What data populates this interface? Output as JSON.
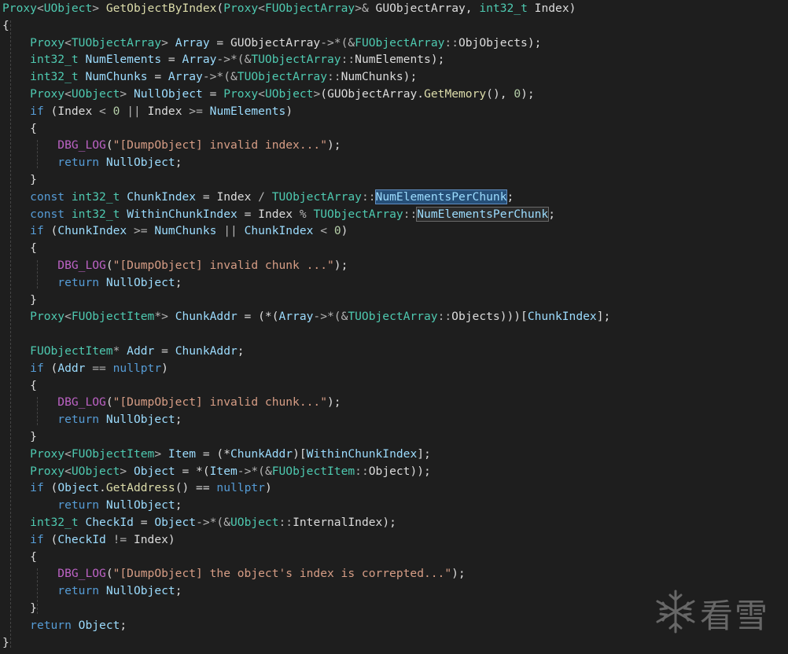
{
  "colors": {
    "background": "#1e1e1e",
    "default": "#dcdcdc",
    "keyword": "#569cd6",
    "type": "#4ec9b0",
    "function": "#dcdcaa",
    "variable": "#9cdcfe",
    "string": "#d69d85",
    "number": "#b5cea8",
    "macro": "#bd63c5",
    "operator": "#b4b4b4",
    "guide": "#444444",
    "watermark": "#7a7a7a"
  },
  "code_lines": [
    [
      [
        "Proxy",
        "type"
      ],
      [
        "<",
        "operator"
      ],
      [
        "UObject",
        "type"
      ],
      [
        "> ",
        "operator"
      ],
      [
        "GetObjectByIndex",
        "function"
      ],
      [
        "(",
        "default"
      ],
      [
        "Proxy",
        "type"
      ],
      [
        "<",
        "operator"
      ],
      [
        "FUObjectArray",
        "type"
      ],
      [
        ">& ",
        "operator"
      ],
      [
        "GUObjectArray",
        "param"
      ],
      [
        ", ",
        "default"
      ],
      [
        "int32_t",
        "type"
      ],
      [
        " ",
        "default"
      ],
      [
        "Index",
        "param"
      ],
      [
        ")",
        "default"
      ]
    ],
    [
      [
        "{",
        "default"
      ]
    ],
    [
      [
        "    ",
        "default"
      ],
      [
        "Proxy",
        "type"
      ],
      [
        "<",
        "operator"
      ],
      [
        "TUObjectArray",
        "type"
      ],
      [
        "> ",
        "operator"
      ],
      [
        "Array",
        "variable"
      ],
      [
        " = ",
        "default"
      ],
      [
        "GUObjectArray",
        "param"
      ],
      [
        "->*(&",
        "operator"
      ],
      [
        "FUObjectArray",
        "type"
      ],
      [
        "::",
        "operator"
      ],
      [
        "ObjObjects",
        "default"
      ],
      [
        ");",
        "default"
      ]
    ],
    [
      [
        "    ",
        "default"
      ],
      [
        "int32_t",
        "type"
      ],
      [
        " ",
        "default"
      ],
      [
        "NumElements",
        "variable"
      ],
      [
        " = ",
        "default"
      ],
      [
        "Array",
        "variable"
      ],
      [
        "->*(&",
        "operator"
      ],
      [
        "TUObjectArray",
        "type"
      ],
      [
        "::",
        "operator"
      ],
      [
        "NumElements",
        "default"
      ],
      [
        ");",
        "default"
      ]
    ],
    [
      [
        "    ",
        "default"
      ],
      [
        "int32_t",
        "type"
      ],
      [
        " ",
        "default"
      ],
      [
        "NumChunks",
        "variable"
      ],
      [
        " = ",
        "default"
      ],
      [
        "Array",
        "variable"
      ],
      [
        "->*(&",
        "operator"
      ],
      [
        "TUObjectArray",
        "type"
      ],
      [
        "::",
        "operator"
      ],
      [
        "NumChunks",
        "default"
      ],
      [
        ");",
        "default"
      ]
    ],
    [
      [
        "    ",
        "default"
      ],
      [
        "Proxy",
        "type"
      ],
      [
        "<",
        "operator"
      ],
      [
        "UObject",
        "type"
      ],
      [
        "> ",
        "operator"
      ],
      [
        "NullObject",
        "variable"
      ],
      [
        " = ",
        "default"
      ],
      [
        "Proxy",
        "type"
      ],
      [
        "<",
        "operator"
      ],
      [
        "UObject",
        "type"
      ],
      [
        ">",
        "operator"
      ],
      [
        "(",
        "default"
      ],
      [
        "GUObjectArray",
        "param"
      ],
      [
        ".",
        "default"
      ],
      [
        "GetMemory",
        "function"
      ],
      [
        "(), ",
        "default"
      ],
      [
        "0",
        "number"
      ],
      [
        ");",
        "default"
      ]
    ],
    [
      [
        "    ",
        "default"
      ],
      [
        "if",
        "keyword"
      ],
      [
        " (",
        "default"
      ],
      [
        "Index",
        "param"
      ],
      [
        " < ",
        "operator"
      ],
      [
        "0",
        "number"
      ],
      [
        " || ",
        "operator"
      ],
      [
        "Index",
        "param"
      ],
      [
        " >= ",
        "operator"
      ],
      [
        "NumElements",
        "variable"
      ],
      [
        ")",
        "default"
      ]
    ],
    [
      [
        "    ",
        "default"
      ],
      [
        "{",
        "default"
      ]
    ],
    [
      [
        "        ",
        "default"
      ],
      [
        "DBG_LOG",
        "macro"
      ],
      [
        "(",
        "default"
      ],
      [
        "\"[DumpObject] invalid index...\"",
        "string"
      ],
      [
        ");",
        "default"
      ]
    ],
    [
      [
        "        ",
        "default"
      ],
      [
        "return",
        "keyword"
      ],
      [
        " ",
        "default"
      ],
      [
        "NullObject",
        "variable"
      ],
      [
        ";",
        "default"
      ]
    ],
    [
      [
        "    ",
        "default"
      ],
      [
        "}",
        "default"
      ]
    ],
    [
      [
        "    ",
        "default"
      ],
      [
        "const",
        "keyword"
      ],
      [
        " ",
        "default"
      ],
      [
        "int32_t",
        "type"
      ],
      [
        " ",
        "default"
      ],
      [
        "ChunkIndex",
        "variable"
      ],
      [
        " = ",
        "default"
      ],
      [
        "Index",
        "param"
      ],
      [
        " / ",
        "operator"
      ],
      [
        "TUObjectArray",
        "type"
      ],
      [
        "::",
        "operator"
      ],
      [
        "NumElementsPerChunk",
        "variable",
        "sel"
      ],
      [
        ";",
        "default"
      ]
    ],
    [
      [
        "    ",
        "default"
      ],
      [
        "const",
        "keyword"
      ],
      [
        " ",
        "default"
      ],
      [
        "int32_t",
        "type"
      ],
      [
        " ",
        "default"
      ],
      [
        "WithinChunkIndex",
        "variable"
      ],
      [
        " = ",
        "default"
      ],
      [
        "Index",
        "param"
      ],
      [
        " % ",
        "operator"
      ],
      [
        "TUObjectArray",
        "type"
      ],
      [
        "::",
        "operator"
      ],
      [
        "NumElementsPerChunk",
        "variable",
        "ref"
      ],
      [
        ";",
        "default"
      ]
    ],
    [
      [
        "    ",
        "default"
      ],
      [
        "if",
        "keyword"
      ],
      [
        " (",
        "default"
      ],
      [
        "ChunkIndex",
        "variable"
      ],
      [
        " >= ",
        "operator"
      ],
      [
        "NumChunks",
        "variable"
      ],
      [
        " || ",
        "operator"
      ],
      [
        "ChunkIndex",
        "variable"
      ],
      [
        " < ",
        "operator"
      ],
      [
        "0",
        "number"
      ],
      [
        ")",
        "default"
      ]
    ],
    [
      [
        "    ",
        "default"
      ],
      [
        "{",
        "default"
      ]
    ],
    [
      [
        "        ",
        "default"
      ],
      [
        "DBG_LOG",
        "macro"
      ],
      [
        "(",
        "default"
      ],
      [
        "\"[DumpObject] invalid chunk ...\"",
        "string"
      ],
      [
        ");",
        "default"
      ]
    ],
    [
      [
        "        ",
        "default"
      ],
      [
        "return",
        "keyword"
      ],
      [
        " ",
        "default"
      ],
      [
        "NullObject",
        "variable"
      ],
      [
        ";",
        "default"
      ]
    ],
    [
      [
        "    ",
        "default"
      ],
      [
        "}",
        "default"
      ]
    ],
    [
      [
        "    ",
        "default"
      ],
      [
        "Proxy",
        "type"
      ],
      [
        "<",
        "operator"
      ],
      [
        "FUObjectItem",
        "type"
      ],
      [
        "*> ",
        "operator"
      ],
      [
        "ChunkAddr",
        "variable"
      ],
      [
        " = (*(",
        "default"
      ],
      [
        "Array",
        "variable"
      ],
      [
        "->*(&",
        "operator"
      ],
      [
        "TUObjectArray",
        "type"
      ],
      [
        "::",
        "operator"
      ],
      [
        "Objects",
        "default"
      ],
      [
        ")))[",
        "default"
      ],
      [
        "ChunkIndex",
        "variable"
      ],
      [
        "];",
        "default"
      ]
    ],
    [],
    [
      [
        "    ",
        "default"
      ],
      [
        "FUObjectItem",
        "type"
      ],
      [
        "* ",
        "operator"
      ],
      [
        "Addr",
        "variable"
      ],
      [
        " = ",
        "default"
      ],
      [
        "ChunkAddr",
        "variable"
      ],
      [
        ";",
        "default"
      ]
    ],
    [
      [
        "    ",
        "default"
      ],
      [
        "if",
        "keyword"
      ],
      [
        " (",
        "default"
      ],
      [
        "Addr",
        "variable"
      ],
      [
        " == ",
        "operator"
      ],
      [
        "nullptr",
        "keyword"
      ],
      [
        ")",
        "default"
      ]
    ],
    [
      [
        "    ",
        "default"
      ],
      [
        "{",
        "default"
      ]
    ],
    [
      [
        "        ",
        "default"
      ],
      [
        "DBG_LOG",
        "macro"
      ],
      [
        "(",
        "default"
      ],
      [
        "\"[DumpObject] invalid chunk...\"",
        "string"
      ],
      [
        ");",
        "default"
      ]
    ],
    [
      [
        "        ",
        "default"
      ],
      [
        "return",
        "keyword"
      ],
      [
        " ",
        "default"
      ],
      [
        "NullObject",
        "variable"
      ],
      [
        ";",
        "default"
      ]
    ],
    [
      [
        "    ",
        "default"
      ],
      [
        "}",
        "default"
      ]
    ],
    [
      [
        "    ",
        "default"
      ],
      [
        "Proxy",
        "type"
      ],
      [
        "<",
        "operator"
      ],
      [
        "FUObjectItem",
        "type"
      ],
      [
        "> ",
        "operator"
      ],
      [
        "Item",
        "variable"
      ],
      [
        " = (*",
        "default"
      ],
      [
        "ChunkAddr",
        "variable"
      ],
      [
        ")[",
        "default"
      ],
      [
        "WithinChunkIndex",
        "variable"
      ],
      [
        "];",
        "default"
      ]
    ],
    [
      [
        "    ",
        "default"
      ],
      [
        "Proxy",
        "type"
      ],
      [
        "<",
        "operator"
      ],
      [
        "UObject",
        "type"
      ],
      [
        "> ",
        "operator"
      ],
      [
        "Object",
        "variable"
      ],
      [
        " = *(",
        "default"
      ],
      [
        "Item",
        "variable"
      ],
      [
        "->*(&",
        "operator"
      ],
      [
        "FUObjectItem",
        "type"
      ],
      [
        "::",
        "operator"
      ],
      [
        "Object",
        "default"
      ],
      [
        "));",
        "default"
      ]
    ],
    [
      [
        "    ",
        "default"
      ],
      [
        "if",
        "keyword"
      ],
      [
        " (",
        "default"
      ],
      [
        "Object",
        "variable"
      ],
      [
        ".",
        "default"
      ],
      [
        "GetAddress",
        "function"
      ],
      [
        "() == ",
        "default"
      ],
      [
        "nullptr",
        "keyword"
      ],
      [
        ")",
        "default"
      ]
    ],
    [
      [
        "        ",
        "default"
      ],
      [
        "return",
        "keyword"
      ],
      [
        " ",
        "default"
      ],
      [
        "NullObject",
        "variable"
      ],
      [
        ";",
        "default"
      ]
    ],
    [
      [
        "    ",
        "default"
      ],
      [
        "int32_t",
        "type"
      ],
      [
        " ",
        "default"
      ],
      [
        "CheckId",
        "variable"
      ],
      [
        " = ",
        "default"
      ],
      [
        "Object",
        "variable"
      ],
      [
        "->*(&",
        "operator"
      ],
      [
        "UObject",
        "type"
      ],
      [
        "::",
        "operator"
      ],
      [
        "InternalIndex",
        "default"
      ],
      [
        ");",
        "default"
      ]
    ],
    [
      [
        "    ",
        "default"
      ],
      [
        "if",
        "keyword"
      ],
      [
        " (",
        "default"
      ],
      [
        "CheckId",
        "variable"
      ],
      [
        " != ",
        "operator"
      ],
      [
        "Index",
        "param"
      ],
      [
        ")",
        "default"
      ]
    ],
    [
      [
        "    ",
        "default"
      ],
      [
        "{",
        "default"
      ]
    ],
    [
      [
        "        ",
        "default"
      ],
      [
        "DBG_LOG",
        "macro"
      ],
      [
        "(",
        "default"
      ],
      [
        "\"[DumpObject] the object's index is correpted...\"",
        "string"
      ],
      [
        ");",
        "default"
      ]
    ],
    [
      [
        "        ",
        "default"
      ],
      [
        "return",
        "keyword"
      ],
      [
        " ",
        "default"
      ],
      [
        "NullObject",
        "variable"
      ],
      [
        ";",
        "default"
      ]
    ],
    [
      [
        "    ",
        "default"
      ],
      [
        "}",
        "default"
      ]
    ],
    [
      [
        "    ",
        "default"
      ],
      [
        "return",
        "keyword"
      ],
      [
        " ",
        "default"
      ],
      [
        "Object",
        "variable"
      ],
      [
        ";",
        "default"
      ]
    ],
    [
      [
        "}",
        "default"
      ]
    ]
  ],
  "watermark": {
    "text": "看雪",
    "icon": "snowflake-icon"
  }
}
